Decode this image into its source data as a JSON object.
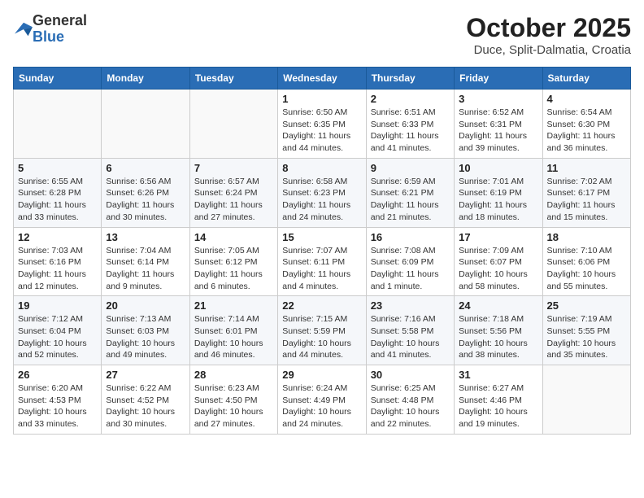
{
  "header": {
    "logo_general": "General",
    "logo_blue": "Blue",
    "title": "October 2025",
    "subtitle": "Duce, Split-Dalmatia, Croatia"
  },
  "calendar": {
    "days_of_week": [
      "Sunday",
      "Monday",
      "Tuesday",
      "Wednesday",
      "Thursday",
      "Friday",
      "Saturday"
    ],
    "weeks": [
      [
        {
          "day": "",
          "info": ""
        },
        {
          "day": "",
          "info": ""
        },
        {
          "day": "",
          "info": ""
        },
        {
          "day": "1",
          "info": "Sunrise: 6:50 AM\nSunset: 6:35 PM\nDaylight: 11 hours and 44 minutes."
        },
        {
          "day": "2",
          "info": "Sunrise: 6:51 AM\nSunset: 6:33 PM\nDaylight: 11 hours and 41 minutes."
        },
        {
          "day": "3",
          "info": "Sunrise: 6:52 AM\nSunset: 6:31 PM\nDaylight: 11 hours and 39 minutes."
        },
        {
          "day": "4",
          "info": "Sunrise: 6:54 AM\nSunset: 6:30 PM\nDaylight: 11 hours and 36 minutes."
        }
      ],
      [
        {
          "day": "5",
          "info": "Sunrise: 6:55 AM\nSunset: 6:28 PM\nDaylight: 11 hours and 33 minutes."
        },
        {
          "day": "6",
          "info": "Sunrise: 6:56 AM\nSunset: 6:26 PM\nDaylight: 11 hours and 30 minutes."
        },
        {
          "day": "7",
          "info": "Sunrise: 6:57 AM\nSunset: 6:24 PM\nDaylight: 11 hours and 27 minutes."
        },
        {
          "day": "8",
          "info": "Sunrise: 6:58 AM\nSunset: 6:23 PM\nDaylight: 11 hours and 24 minutes."
        },
        {
          "day": "9",
          "info": "Sunrise: 6:59 AM\nSunset: 6:21 PM\nDaylight: 11 hours and 21 minutes."
        },
        {
          "day": "10",
          "info": "Sunrise: 7:01 AM\nSunset: 6:19 PM\nDaylight: 11 hours and 18 minutes."
        },
        {
          "day": "11",
          "info": "Sunrise: 7:02 AM\nSunset: 6:17 PM\nDaylight: 11 hours and 15 minutes."
        }
      ],
      [
        {
          "day": "12",
          "info": "Sunrise: 7:03 AM\nSunset: 6:16 PM\nDaylight: 11 hours and 12 minutes."
        },
        {
          "day": "13",
          "info": "Sunrise: 7:04 AM\nSunset: 6:14 PM\nDaylight: 11 hours and 9 minutes."
        },
        {
          "day": "14",
          "info": "Sunrise: 7:05 AM\nSunset: 6:12 PM\nDaylight: 11 hours and 6 minutes."
        },
        {
          "day": "15",
          "info": "Sunrise: 7:07 AM\nSunset: 6:11 PM\nDaylight: 11 hours and 4 minutes."
        },
        {
          "day": "16",
          "info": "Sunrise: 7:08 AM\nSunset: 6:09 PM\nDaylight: 11 hours and 1 minute."
        },
        {
          "day": "17",
          "info": "Sunrise: 7:09 AM\nSunset: 6:07 PM\nDaylight: 10 hours and 58 minutes."
        },
        {
          "day": "18",
          "info": "Sunrise: 7:10 AM\nSunset: 6:06 PM\nDaylight: 10 hours and 55 minutes."
        }
      ],
      [
        {
          "day": "19",
          "info": "Sunrise: 7:12 AM\nSunset: 6:04 PM\nDaylight: 10 hours and 52 minutes."
        },
        {
          "day": "20",
          "info": "Sunrise: 7:13 AM\nSunset: 6:03 PM\nDaylight: 10 hours and 49 minutes."
        },
        {
          "day": "21",
          "info": "Sunrise: 7:14 AM\nSunset: 6:01 PM\nDaylight: 10 hours and 46 minutes."
        },
        {
          "day": "22",
          "info": "Sunrise: 7:15 AM\nSunset: 5:59 PM\nDaylight: 10 hours and 44 minutes."
        },
        {
          "day": "23",
          "info": "Sunrise: 7:16 AM\nSunset: 5:58 PM\nDaylight: 10 hours and 41 minutes."
        },
        {
          "day": "24",
          "info": "Sunrise: 7:18 AM\nSunset: 5:56 PM\nDaylight: 10 hours and 38 minutes."
        },
        {
          "day": "25",
          "info": "Sunrise: 7:19 AM\nSunset: 5:55 PM\nDaylight: 10 hours and 35 minutes."
        }
      ],
      [
        {
          "day": "26",
          "info": "Sunrise: 6:20 AM\nSunset: 4:53 PM\nDaylight: 10 hours and 33 minutes."
        },
        {
          "day": "27",
          "info": "Sunrise: 6:22 AM\nSunset: 4:52 PM\nDaylight: 10 hours and 30 minutes."
        },
        {
          "day": "28",
          "info": "Sunrise: 6:23 AM\nSunset: 4:50 PM\nDaylight: 10 hours and 27 minutes."
        },
        {
          "day": "29",
          "info": "Sunrise: 6:24 AM\nSunset: 4:49 PM\nDaylight: 10 hours and 24 minutes."
        },
        {
          "day": "30",
          "info": "Sunrise: 6:25 AM\nSunset: 4:48 PM\nDaylight: 10 hours and 22 minutes."
        },
        {
          "day": "31",
          "info": "Sunrise: 6:27 AM\nSunset: 4:46 PM\nDaylight: 10 hours and 19 minutes."
        },
        {
          "day": "",
          "info": ""
        }
      ]
    ]
  }
}
